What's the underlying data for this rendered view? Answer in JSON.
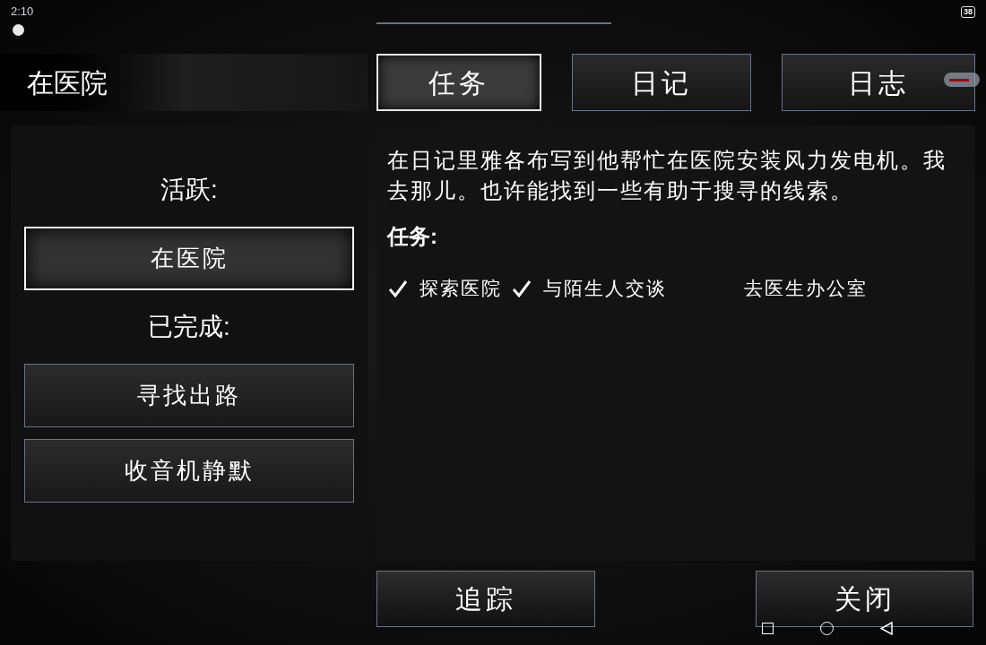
{
  "status_bar": {
    "time": "2:10",
    "battery": "38"
  },
  "location_title": "在医院",
  "tabs": [
    {
      "label": "任务",
      "selected": true
    },
    {
      "label": "日记",
      "selected": false
    },
    {
      "label": "日志",
      "selected": false
    }
  ],
  "quest_list": {
    "active_heading": "活跃:",
    "active": [
      {
        "label": "在医院",
        "selected": true
      }
    ],
    "completed_heading": "已完成:",
    "completed": [
      {
        "label": "寻找出路",
        "selected": false
      },
      {
        "label": "收音机静默",
        "selected": false
      }
    ]
  },
  "details": {
    "description": "在日记里雅各布写到他帮忙在医院安装风力发电机。我去那儿。也许能找到一些有助于搜寻的线索。",
    "tasks_heading": "任务:",
    "tasks": [
      {
        "label": "探索医院",
        "checked": true
      },
      {
        "label": "与陌生人交谈",
        "checked": true
      },
      {
        "label": "去医生办公室",
        "checked": false
      }
    ]
  },
  "buttons": [
    {
      "label": "追踪"
    },
    {
      "label": "关闭"
    }
  ]
}
